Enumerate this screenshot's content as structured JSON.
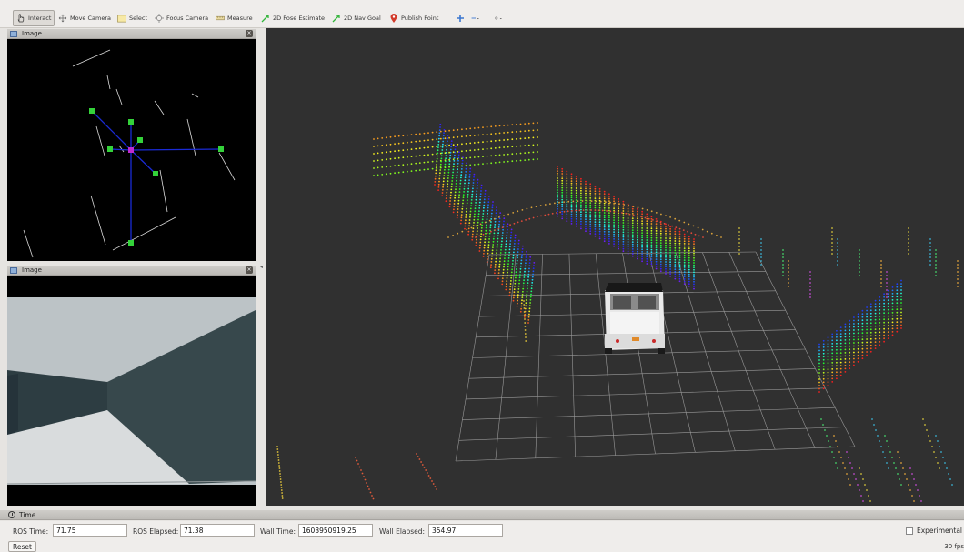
{
  "toolbar": {
    "interact": "Interact",
    "move_camera": "Move Camera",
    "select": "Select",
    "focus_camera": "Focus Camera",
    "measure": "Measure",
    "pose_estimate": "2D Pose Estimate",
    "nav_goal": "2D Nav Goal",
    "publish_point": "Publish Point"
  },
  "panels": [
    {
      "title": "Image"
    },
    {
      "title": "Image"
    }
  ],
  "time": {
    "title": "Time",
    "ros_time_label": "ROS Time:",
    "ros_time": "71.75",
    "ros_elapsed_label": "ROS Elapsed:",
    "ros_elapsed": "71.38",
    "wall_time_label": "Wall Time:",
    "wall_time": "1603950919.25",
    "wall_elapsed_label": "Wall Elapsed:",
    "wall_elapsed": "354.97",
    "experimental": "Experimental"
  },
  "footer": {
    "reset": "Reset",
    "fps": "30 fps"
  },
  "colors": {
    "toolbar_bg": "#efedeb",
    "viewport_bg": "#303030",
    "node_green": "#34d23a",
    "edge_blue": "#1a2bd6"
  },
  "icons": [
    "hand-pointer-icon",
    "move-camera-icon",
    "select-rect-icon",
    "focus-camera-icon",
    "ruler-icon",
    "green-arrow-icon",
    "map-pin-icon",
    "plus-icon",
    "minus-dropdown-icon",
    "eye-dropdown-icon"
  ]
}
